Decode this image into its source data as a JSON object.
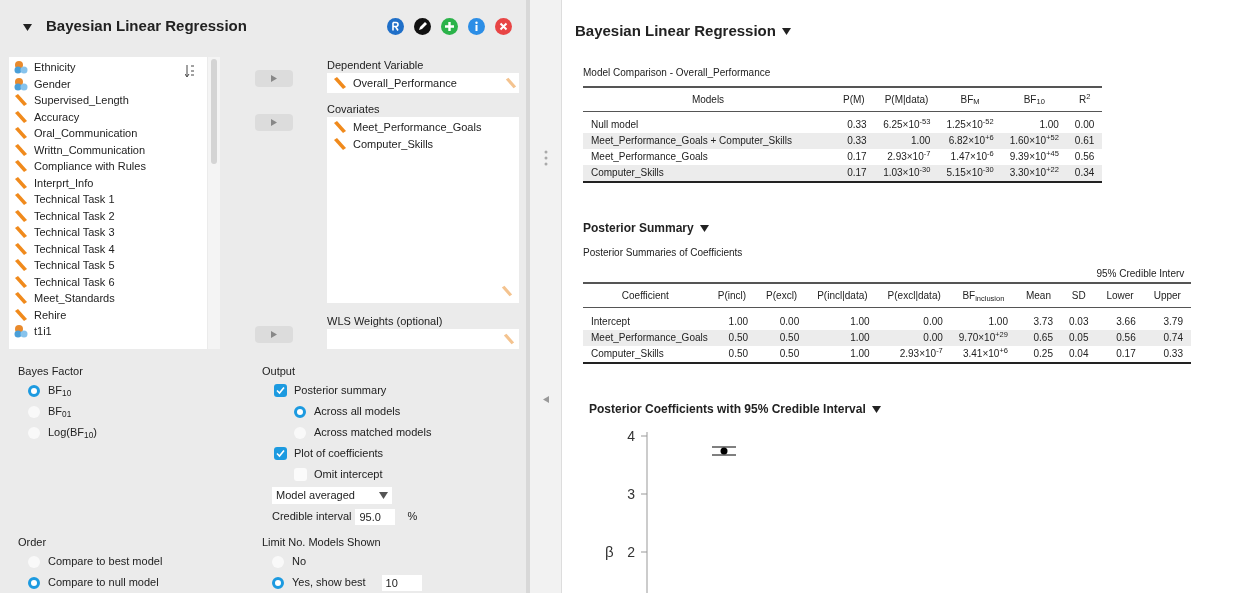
{
  "analysis": {
    "title": "Bayesian Linear Regression",
    "expanded": true
  },
  "variables": [
    {
      "name": "Ethnicity",
      "kind": "nominal"
    },
    {
      "name": "Gender",
      "kind": "nominal"
    },
    {
      "name": "Supervised_Length",
      "kind": "scale"
    },
    {
      "name": "Accuracy",
      "kind": "scale"
    },
    {
      "name": "Oral_Communication",
      "kind": "scale"
    },
    {
      "name": "Writtn_Communication",
      "kind": "scale"
    },
    {
      "name": "Compliance with Rules",
      "kind": "scale"
    },
    {
      "name": "Interprt_Info",
      "kind": "scale"
    },
    {
      "name": "Technical Task 1",
      "kind": "scale"
    },
    {
      "name": "Technical Task 2",
      "kind": "scale"
    },
    {
      "name": "Technical Task 3",
      "kind": "scale"
    },
    {
      "name": "Technical Task 4",
      "kind": "scale"
    },
    {
      "name": "Technical Task 5",
      "kind": "scale"
    },
    {
      "name": "Technical Task 6",
      "kind": "scale"
    },
    {
      "name": "Meet_Standards",
      "kind": "scale"
    },
    {
      "name": "Rehire",
      "kind": "scale"
    },
    {
      "name": "t1i1",
      "kind": "nominal"
    }
  ],
  "dependent": {
    "label": "Dependent Variable",
    "items": [
      {
        "name": "Overall_Performance",
        "kind": "scale"
      }
    ]
  },
  "covariates": {
    "label": "Covariates",
    "items": [
      {
        "name": "Meet_Performance_Goals",
        "kind": "scale"
      },
      {
        "name": "Computer_Skills",
        "kind": "scale"
      }
    ]
  },
  "wls": {
    "label": "WLS Weights (optional)"
  },
  "bayes_factor": {
    "label": "Bayes Factor",
    "options": [
      {
        "label": "BF$_{10}$",
        "selected": true
      },
      {
        "label": "BF$_{01}$",
        "selected": false
      },
      {
        "label": "Log(BF$_{10}$)",
        "selected": false
      }
    ]
  },
  "output": {
    "label": "Output",
    "items": [
      {
        "kind": "checkbox",
        "label": "Posterior summary",
        "checked": true
      },
      {
        "kind": "radio",
        "label": "Across all models",
        "selected": true
      },
      {
        "kind": "radio",
        "label": "Across matched models",
        "selected": false
      },
      {
        "kind": "checkbox",
        "label": "Plot of coefficients",
        "checked": true
      },
      {
        "kind": "subcheckbox",
        "label": "Omit intercept",
        "checked": false
      },
      {
        "kind": "dropdown",
        "value": "Model averaged"
      },
      {
        "kind": "number",
        "label": "Credible interval",
        "value": "95.0",
        "unit": "%"
      }
    ]
  },
  "order": {
    "label": "Order",
    "options": [
      {
        "label": "Compare to best model",
        "selected": false
      },
      {
        "label": "Compare to null model",
        "selected": true
      }
    ]
  },
  "limit": {
    "label": "Limit No. Models Shown",
    "options": [
      {
        "label": "No",
        "selected": false
      },
      {
        "label": "Yes, show best",
        "selected": true,
        "value": "10"
      }
    ]
  },
  "results": {
    "title": "Bayesian Linear Regression",
    "model_comparison": {
      "title": "Model Comparison - Overall_Performance",
      "columns": [
        "Models",
        "P(M)",
        "P(M|data)",
        "BF$_{M}$",
        "BF$_{10}$",
        "R$^{2}$"
      ],
      "rows": [
        [
          "Null model",
          "0.33",
          "6.25×10$^{-53}$",
          "1.25×10$^{-52}$",
          "1.00",
          "0.00"
        ],
        [
          "Meet_Performance_Goals + Computer_Skills",
          "0.33",
          "1.00",
          "6.82×10$^{+6}$",
          "1.60×10$^{+52}$",
          "0.61"
        ],
        [
          "Meet_Performance_Goals",
          "0.17",
          "2.93×10$^{-7}$",
          "1.47×10$^{-6}$",
          "9.39×10$^{+45}$",
          "0.56"
        ],
        [
          "Computer_Skills",
          "0.17",
          "1.03×10$^{-30}$",
          "5.15×10$^{-30}$",
          "3.30×10$^{+22}$",
          "0.34"
        ]
      ]
    },
    "posterior_summary": {
      "heading": "Posterior Summary",
      "title": "Posterior Summaries of Coefficients",
      "group_header": "95% Credible Interv",
      "columns": [
        "Coefficient",
        "P(incl)",
        "P(excl)",
        "P(incl|data)",
        "P(excl|data)",
        "BF$_{inclusion}$",
        "Mean",
        "SD",
        "Lower",
        "Upper"
      ],
      "rows": [
        [
          "Intercept",
          "1.00",
          "0.00",
          "1.00",
          "0.00",
          "1.00",
          "3.73",
          "0.03",
          "3.66",
          "3.79"
        ],
        [
          "Meet_Performance_Goals",
          "0.50",
          "0.50",
          "1.00",
          "0.00",
          "9.70×10$^{+29}$",
          "0.65",
          "0.05",
          "0.56",
          "0.74"
        ],
        [
          "Computer_Skills",
          "0.50",
          "0.50",
          "1.00",
          "2.93×10$^{-7}$",
          "3.41×10$^{+6}$",
          "0.25",
          "0.04",
          "0.17",
          "0.33"
        ]
      ]
    },
    "plot": {
      "heading": "Posterior Coefficients with 95% Credible Interval",
      "y_axis": {
        "label": "β",
        "ticks": [
          "4",
          "3",
          "2"
        ]
      }
    }
  }
}
